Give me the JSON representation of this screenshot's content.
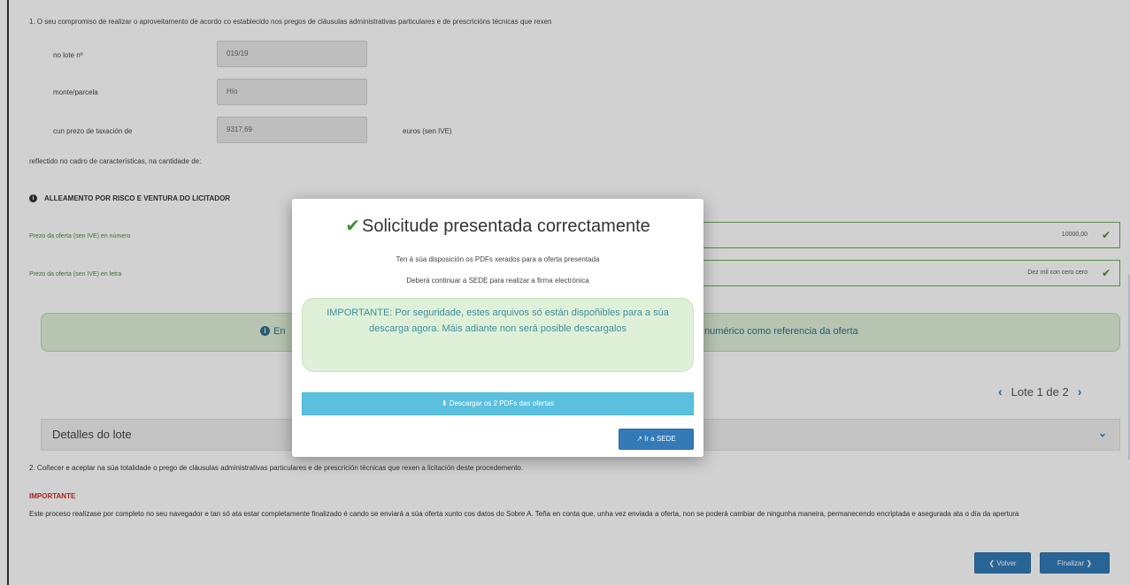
{
  "form": {
    "intro": "1. O seu compromiso de realizar o aproveitamento de acordo co establecido nos pregos de cláusulas administrativas particulares e de prescricións técnicas que rexen",
    "lot_label": "no lote nº",
    "lot_value": "019/19",
    "parcel_label": "monte/parcela",
    "parcel_value": "Hío",
    "price_label": "cun prezo de taxación de",
    "price_value": "9317,69",
    "price_suffix": "euros (sen IVE)",
    "reflected": "reflectido no cadro de características, na cantidade de:",
    "section_title": "ALLEAMENTO POR RISCO E VENTURA DO LICITADOR",
    "offer_number_label": "Prezo da oferta (sen IVE) en número",
    "offer_number_value": "10000,00",
    "offer_text_label": "Prezo da oferta (sen IVE) en letra",
    "offer_text_value": "Dez mil con cero cero"
  },
  "banner": {
    "left_text": "En",
    "right_text": "numérico como referencia da oferta"
  },
  "pager": {
    "text": "Lote 1 de 2"
  },
  "lot_panel": {
    "title": "Detalles do lote"
  },
  "accept": {
    "text": "2. Coñecer e aceptar na súa totalidade o prego de cláusulas administrativas particulares e de prescrición técnicas que rexen a licitación deste procedemento."
  },
  "important": {
    "title": "IMPORTANTE",
    "body": "Este proceso realízase por completo no seu navegador e tan só ata estar completamente finalizado é cando se enviará a súa oferta xunto cos datos do Sobre A. Teña en conta que, unha vez enviada a oferta, non se poderá cambiar de ningunha maneira, permanecendo encriptada e asegurada ata o día da apertura"
  },
  "buttons": {
    "back": "Volver",
    "finish": "Finalizar"
  },
  "modal": {
    "title": "Solicitude presentada correctamente",
    "line1": "Ten á súa disposición os PDFs xerados para a oferta presentada",
    "line2": "Deberá continuar a SEDE para realizar a firma electrónica",
    "alert": "IMPORTANTE: Por seguridade, estes arquivos só están dispoñibles para a súa descarga agora. Máis adiante non será posible descargalos",
    "download": "Descargar os 2 PDFs das ofertas",
    "sede": "Ir a SEDE"
  },
  "icons": {
    "check": "check-icon",
    "info": "info-icon",
    "download": "download-icon",
    "external": "external-link-icon",
    "chevron_left": "chevron-left-icon",
    "chevron_right": "chevron-right-icon",
    "chevron_down": "chevron-down-icon"
  }
}
